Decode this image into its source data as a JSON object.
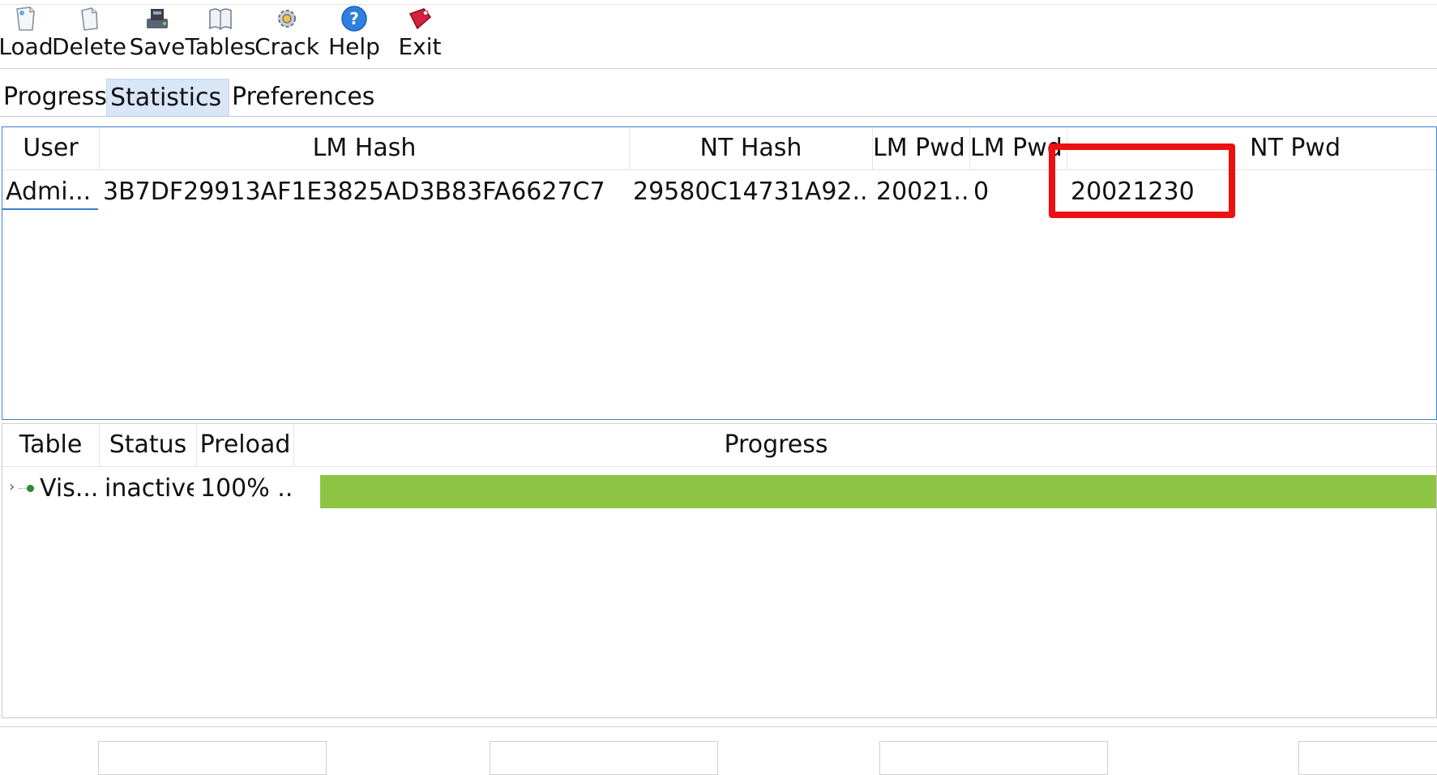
{
  "toolbar": {
    "buttons": [
      {
        "label": "Load",
        "icon": "load-icon"
      },
      {
        "label": "Delete",
        "icon": "delete-icon"
      },
      {
        "label": "Save",
        "icon": "save-icon"
      },
      {
        "label": "Tables",
        "icon": "tables-icon"
      },
      {
        "label": "Crack",
        "icon": "crack-icon"
      },
      {
        "label": "Help",
        "icon": "help-icon"
      },
      {
        "label": "Exit",
        "icon": "exit-icon"
      }
    ]
  },
  "tabs": [
    "Progress",
    "Statistics",
    "Preferences"
  ],
  "active_tab": "Statistics",
  "hash_table": {
    "columns": [
      "User",
      "LM Hash",
      "NT Hash",
      "LM Pwd",
      "LM Pwd",
      "NT Pwd"
    ],
    "rows": [
      {
        "user": "Admi...",
        "lm_hash": "3B7DF29913AF1E3825AD3B83FA6627C7",
        "nt_hash": "29580C14731A92...",
        "lm_pwd1": "20021...",
        "lm_pwd2": "0",
        "nt_pwd": "20021230"
      }
    ]
  },
  "tables_list": {
    "columns": [
      "Table",
      "Status",
      "Preload",
      "Progress"
    ],
    "rows": [
      {
        "table": "Vis...",
        "status": "inactive",
        "preload": "100% ...",
        "progress_fraction": 1.0
      }
    ]
  },
  "colors": {
    "accent": "#3c7fd1",
    "highlight": "#ee1010",
    "progress": "#8dc443",
    "tab_active": "#d8e6f8"
  }
}
